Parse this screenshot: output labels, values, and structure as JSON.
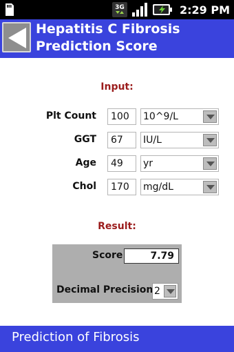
{
  "status_bar": {
    "network": "3G",
    "time": "2:29 PM"
  },
  "header": {
    "title": "Hepatitis C Fibrosis\nPrediction Score"
  },
  "input_section": {
    "label": "Input:",
    "rows": [
      {
        "label": "Plt Count",
        "value": "100",
        "unit": "10^9/L"
      },
      {
        "label": "GGT",
        "value": "67",
        "unit": "IU/L"
      },
      {
        "label": "Age",
        "value": "49",
        "unit": "yr"
      },
      {
        "label": "Chol",
        "value": "170",
        "unit": "mg/dL"
      }
    ]
  },
  "result_section": {
    "label": "Result:",
    "score_label": "Score",
    "score_value": "7.79",
    "precision_label": "Decimal Precision:",
    "precision_value": "2"
  },
  "footer": {
    "label": "Prediction of Fibrosis"
  },
  "colors": {
    "header_bg": "#3a43dd",
    "section_label": "#9b1c1c",
    "panel_bg": "#aeaeae"
  }
}
